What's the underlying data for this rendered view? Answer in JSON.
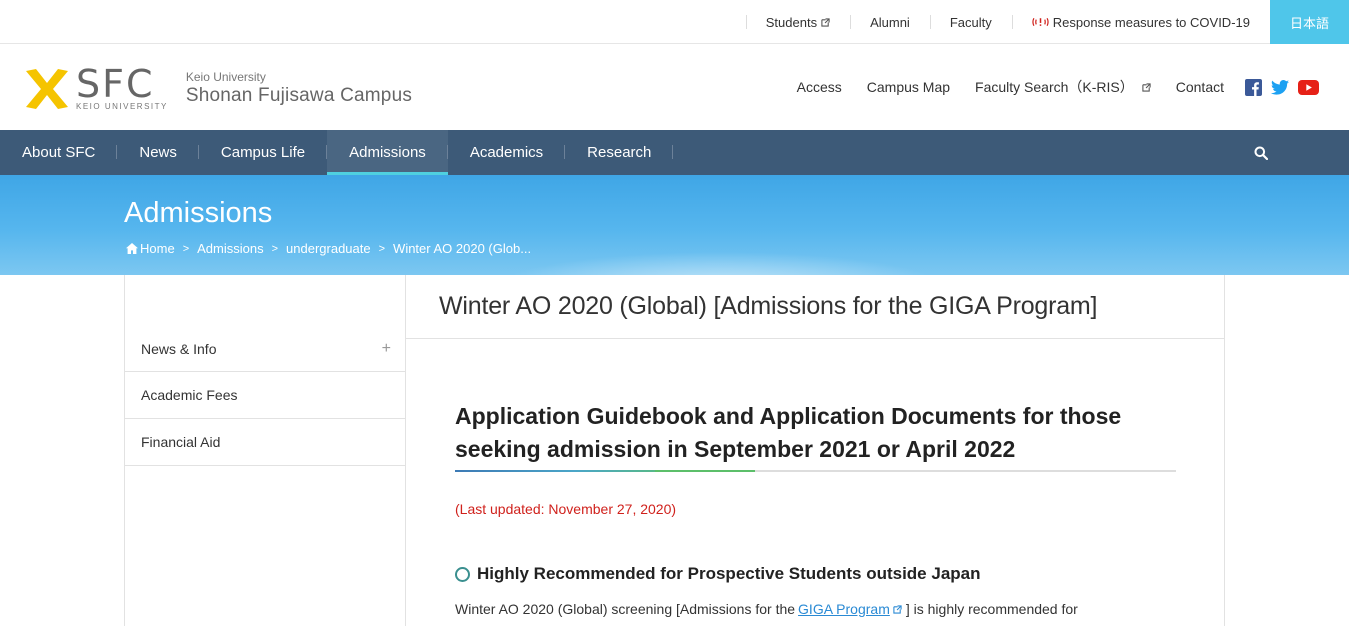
{
  "utility": {
    "links": [
      "Students",
      "Alumni",
      "Faculty"
    ],
    "covid": "Response measures to COVID-19",
    "lang": "日本語"
  },
  "logo": {
    "sfc": "SFC",
    "sfc_sub": "KEIO UNIVERSITY",
    "keio": "Keio University",
    "campus": "Shonan Fujisawa Campus"
  },
  "header_nav": [
    "Access",
    "Campus Map",
    "Faculty Search（K-RIS）",
    "Contact"
  ],
  "main_nav": [
    "About SFC",
    "News",
    "Campus Life",
    "Admissions",
    "Academics",
    "Research"
  ],
  "hero": {
    "title": "Admissions",
    "breadcrumbs": [
      "Home",
      "Admissions",
      "undergraduate",
      "Winter AO 2020 (Glob..."
    ]
  },
  "sidebar": [
    "News & Info",
    "Academic Fees",
    "Financial Aid"
  ],
  "content": {
    "page_title": "Winter AO 2020 (Global) [Admissions for the GIGA Program]",
    "section_title": "Application Guidebook and Application Documents for those seeking admission in September 2021 or April 2022",
    "updated": "(Last updated: November 27, 2020)",
    "sub_heading": "Highly Recommended for Prospective Students outside Japan",
    "para_before": "Winter AO 2020 (Global) screening [Admissions for the",
    "para_link": "GIGA Program",
    "para_after": "] is highly recommended for"
  },
  "colors": {
    "nav_bg": "#3d5a78",
    "lang_bg": "#4fc6ea",
    "accent": "#4fd0e0",
    "updated_red": "#d0211c",
    "logo_yellow": "#f5c400"
  }
}
